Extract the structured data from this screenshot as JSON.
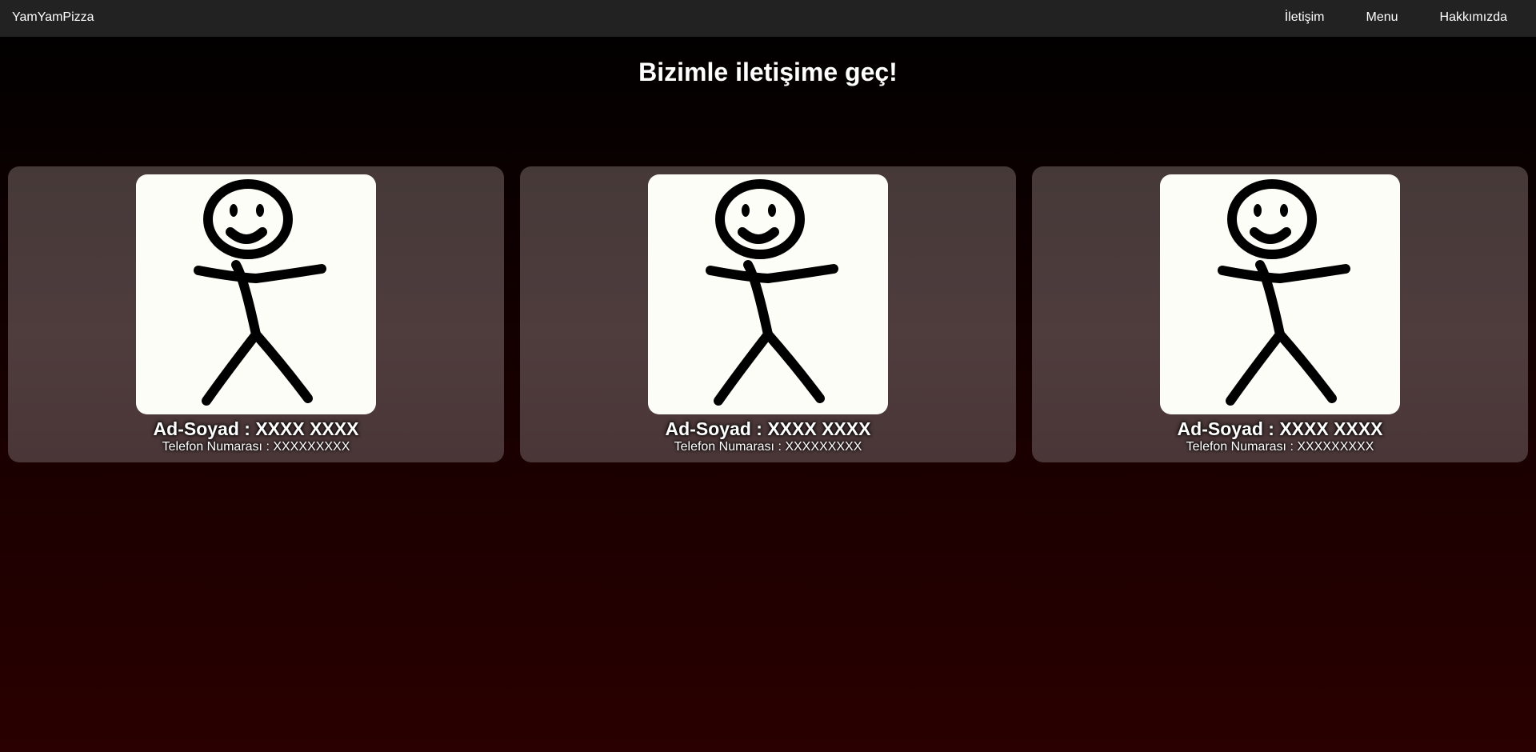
{
  "navbar": {
    "brand": "YamYamPizza",
    "links": [
      {
        "label": "İletişim"
      },
      {
        "label": "Menu"
      },
      {
        "label": "Hakkımızda"
      }
    ]
  },
  "page": {
    "title": "Bizimle iletişime geç!"
  },
  "cards": [
    {
      "name": "Ad-Soyad : XXXX XXXX",
      "phone": "Telefon Numarası : XXXXXXXXX",
      "avatar_icon": "stick-figure-icon"
    },
    {
      "name": "Ad-Soyad : XXXX XXXX",
      "phone": "Telefon Numarası : XXXXXXXXX",
      "avatar_icon": "stick-figure-icon"
    },
    {
      "name": "Ad-Soyad : XXXX XXXX",
      "phone": "Telefon Numarası : XXXXXXXXX",
      "avatar_icon": "stick-figure-icon"
    }
  ],
  "colors": {
    "navbar_bg": "#222222",
    "card_bg": "#4a3838",
    "page_bg_top": "#000000",
    "page_bg_bottom": "#2a0000"
  }
}
